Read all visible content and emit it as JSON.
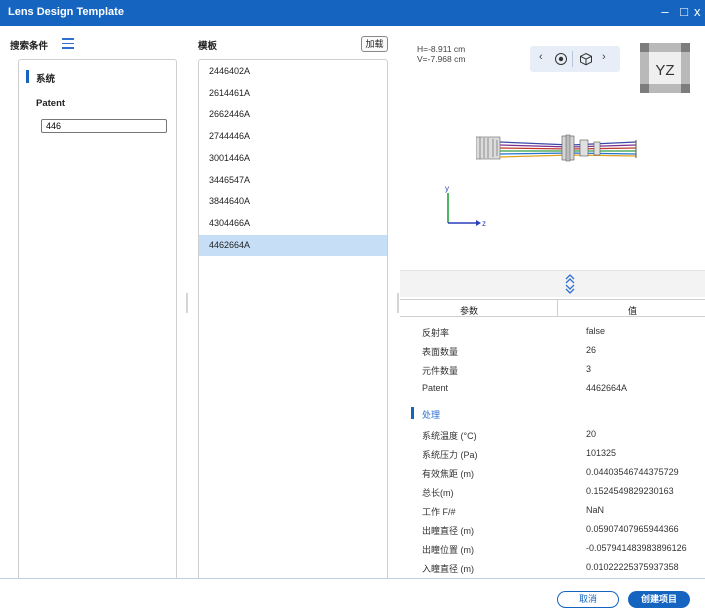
{
  "window": {
    "title": "Lens Design Template",
    "minimize": "–",
    "maximize": "□",
    "close": "x"
  },
  "search": {
    "header": "搜索条件",
    "section_label": "系统",
    "patent_label": "Patent",
    "patent_value": "446"
  },
  "templates": {
    "header": "模板",
    "load_button": "加载",
    "items": [
      "2446402A",
      "2614461A",
      "2662446A",
      "2744446A",
      "3001446A",
      "3446547A",
      "3844640A",
      "4304466A",
      "4462664A"
    ],
    "selected": "4462664A"
  },
  "viewport": {
    "h_readout": "H=-8.911 cm",
    "v_readout": "V=-7.968 cm",
    "view_cube_label": "YZ",
    "axis_y": "y",
    "axis_z": "z",
    "nav_prev_icon": "chevron-left-icon",
    "nav_next_icon": "chevron-right-icon"
  },
  "props": {
    "col_param": "参数",
    "col_value": "值",
    "rows_top": [
      {
        "k": "反射率",
        "v": "false"
      },
      {
        "k": "表面数量",
        "v": "26"
      },
      {
        "k": "元件数量",
        "v": "3"
      },
      {
        "k": "Patent",
        "v": "4462664A"
      }
    ],
    "group_label": "处理",
    "rows_group": [
      {
        "k": "系统温度 (°C)",
        "v": "20"
      },
      {
        "k": "系统压力 (Pa)",
        "v": "101325"
      },
      {
        "k": "有效焦距 (m)",
        "v": "0.04403546744375729"
      },
      {
        "k": "总长(m)",
        "v": "0.1524549829230163"
      },
      {
        "k": "工作 F/#",
        "v": "NaN"
      },
      {
        "k": "出瞳直径 (m)",
        "v": "0.05907407965944366"
      },
      {
        "k": "出瞳位置 (m)",
        "v": "-0.057941483983896126"
      },
      {
        "k": "入瞳直径 (m)",
        "v": "0.01022225375937358"
      }
    ]
  },
  "footer": {
    "cancel": "取消",
    "create": "创建项目"
  },
  "colors": {
    "accent": "#1565c0",
    "selection": "#c6dff7"
  }
}
